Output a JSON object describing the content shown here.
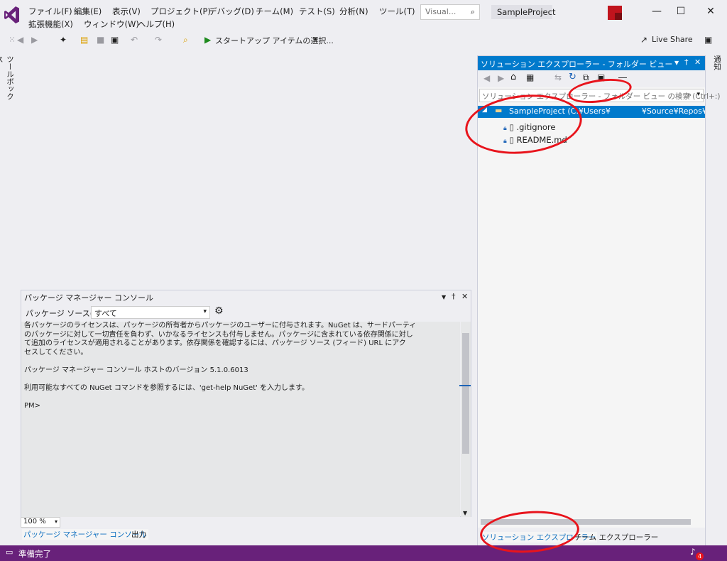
{
  "menu": {
    "row1": [
      "ファイル(F)",
      "編集(E)",
      "表示(V)",
      "プロジェクト(P)",
      "デバッグ(D)",
      "チーム(M)",
      "テスト(S)",
      "分析(N)",
      "ツール(T)"
    ],
    "row2": [
      "拡張機能(X)",
      "ウィンドウ(W)",
      "ヘルプ(H)"
    ]
  },
  "search": {
    "placeholder": "Visual..."
  },
  "project_name": "SampleProject",
  "toolbar": {
    "start_label": "スタートアップ アイテムの選択...",
    "live_share": "Live Share"
  },
  "toolbox_label": "ツールボックス",
  "right_strip_label": "通知",
  "solution_explorer": {
    "title": "ソリューション エクスプローラー - フォルダー ビュー",
    "search_placeholder": "ソリューション エクスプローラー - フォルダー ビュー の検索 (Ctrl+:)",
    "root": "SampleProject (C:¥Users¥    ¥Source¥Repos¥SamplePr",
    "items": [
      ".gitignore",
      "README.md"
    ],
    "tabs": [
      "ソリューション エクスプローラー",
      "チーム エクスプローラー"
    ]
  },
  "package_manager": {
    "title": "パッケージ マネージャー コンソール",
    "source_label": "パッケージ ソース(K):",
    "source_value": "すべて",
    "lines": [
      "各パッケージのライセンスは、パッケージの所有者からパッケージのユーザーに付与されます。NuGet は、サードパーティ",
      "のパッケージに対して一切責任を負わず、いかなるライセンスも付与しません。パッケージに含まれている依存関係に対し",
      "て追加のライセンスが適用されることがあります。依存関係を確認するには、パッケージ ソース (フィード) URL にアク",
      "セスしてください。",
      "",
      "パッケージ マネージャー コンソール ホストのバージョン 5.1.0.6013",
      "",
      "利用可能なすべての NuGet コマンドを参照するには、'get-help NuGet' を入力します。",
      "",
      "PM>"
    ],
    "zoom": "100 %"
  },
  "bottom_tabs": [
    "パッケージ マネージャー コンソール",
    "出力"
  ],
  "status": {
    "text": "準備完了",
    "notifications": "4"
  },
  "colors": {
    "accent": "#007acc",
    "status_bar": "#68217a",
    "annotation": "#e8141c"
  }
}
